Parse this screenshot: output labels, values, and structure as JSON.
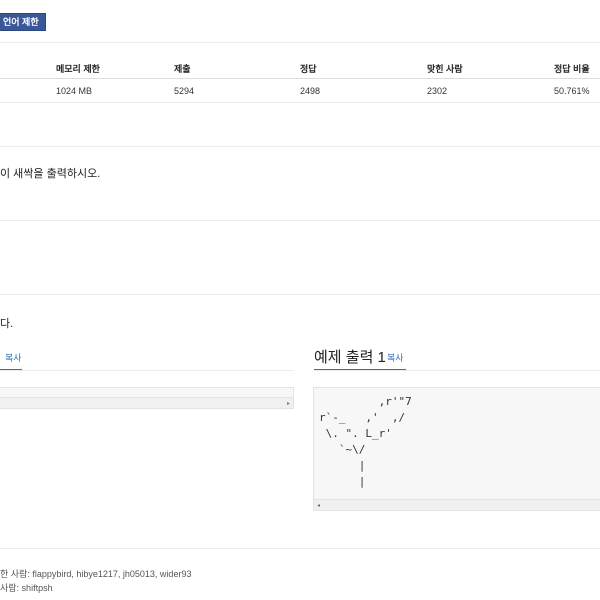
{
  "badge": {
    "label": "언어 제한"
  },
  "stats_table": {
    "headers": [
      "메모리 제한",
      "제출",
      "정답",
      "맞힌 사람",
      "정답 비율"
    ],
    "values": [
      "1024 MB",
      "5294",
      "2498",
      "2302",
      "50.761%"
    ]
  },
  "problem": {
    "output_text": "이 새싹을 출력하시오."
  },
  "input_section": {
    "text": "다."
  },
  "sample_input": {
    "copy_label": "복사"
  },
  "sample_output": {
    "title": "예제 출력 1",
    "copy_label": "복사",
    "content": "         ,r'\"7\nr`-_   ,'  ,/\n \\. \". L_r'\n   `~\\/\n      |\n      |"
  },
  "credits": {
    "line1": "한 사람: flappybird, hibye1217, jh05013, wider93",
    "line2": "사람: shiftpsh"
  }
}
